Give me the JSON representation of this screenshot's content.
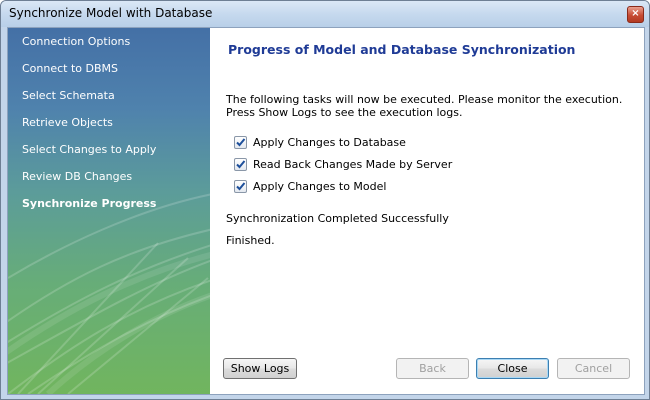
{
  "window": {
    "title": "Synchronize Model with Database",
    "close_glyph": "×"
  },
  "sidebar": {
    "items": [
      {
        "label": "Connection Options"
      },
      {
        "label": "Connect to DBMS"
      },
      {
        "label": "Select Schemata"
      },
      {
        "label": "Retrieve Objects"
      },
      {
        "label": "Select Changes to Apply"
      },
      {
        "label": "Review DB Changes"
      },
      {
        "label": "Synchronize Progress",
        "active": true
      }
    ]
  },
  "main": {
    "heading": "Progress of Model and Database Synchronization",
    "intro_line1": "The following tasks will now be executed. Please monitor the execution.",
    "intro_line2": "Press Show Logs to see the execution logs.",
    "tasks": [
      {
        "label": "Apply Changes to Database",
        "checked": true
      },
      {
        "label": "Read Back Changes Made by Server",
        "checked": true
      },
      {
        "label": "Apply Changes to Model",
        "checked": true
      }
    ],
    "status_message": "Synchronization Completed Successfully",
    "finished_message": "Finished."
  },
  "buttons": {
    "show_logs": "Show Logs",
    "back": "Back",
    "close": "Close",
    "cancel": "Cancel"
  },
  "colors": {
    "heading": "#1f3b96",
    "sidebar_top": "#4470a6",
    "sidebar_bottom": "#71b55e",
    "check_mark": "#1d4f9b"
  }
}
